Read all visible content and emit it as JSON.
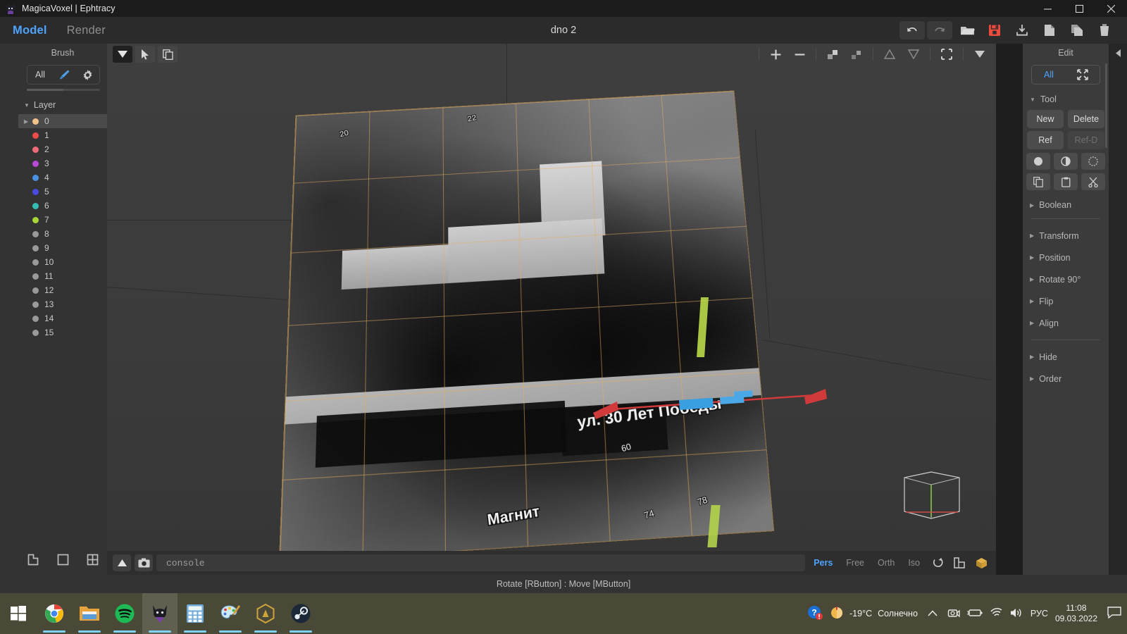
{
  "window": {
    "title": "MagicaVoxel | Ephtracy",
    "app_icon": "cat-icon",
    "controls": {
      "minimize": "minimize-icon",
      "maximize": "maximize-icon",
      "close": "close-icon"
    }
  },
  "menubar": {
    "items": [
      {
        "label": "Model",
        "active": true
      },
      {
        "label": "Render",
        "active": false
      }
    ],
    "document_title": "dno 2",
    "tools": [
      {
        "name": "undo-button",
        "icon": "undo-icon",
        "boxed": true,
        "color": "#cfcfcf"
      },
      {
        "name": "redo-button",
        "icon": "redo-icon",
        "boxed": true,
        "color": "#7a7a7a"
      },
      {
        "name": "open-button",
        "icon": "folder-open-icon",
        "boxed": false,
        "color": "#c6c6c6"
      },
      {
        "name": "save-button",
        "icon": "save-icon",
        "boxed": false,
        "color": "#ef4b3c"
      },
      {
        "name": "export-button",
        "icon": "download-icon",
        "boxed": false,
        "color": "#c6c6c6"
      },
      {
        "name": "new-button",
        "icon": "file-icon",
        "boxed": false,
        "color": "#c6c6c6"
      },
      {
        "name": "duplicate-button",
        "icon": "copy-icon",
        "boxed": false,
        "color": "#c6c6c6"
      },
      {
        "name": "delete-button",
        "icon": "trash-icon",
        "boxed": false,
        "color": "#c6c6c6"
      }
    ]
  },
  "left_panel": {
    "header": "Brush",
    "brush_bar": {
      "all_label": "All",
      "brush_icon": "paintbrush-icon",
      "settings_icon": "gear-icon"
    },
    "layer_section_label": "Layer",
    "layers": [
      {
        "index": "0",
        "color": "#f2c38a",
        "selected": true
      },
      {
        "index": "1",
        "color": "#f04b4b",
        "selected": false
      },
      {
        "index": "2",
        "color": "#f06a7a",
        "selected": false
      },
      {
        "index": "3",
        "color": "#b44ad6",
        "selected": false
      },
      {
        "index": "4",
        "color": "#4a8fe0",
        "selected": false
      },
      {
        "index": "5",
        "color": "#4a4ae0",
        "selected": false
      },
      {
        "index": "6",
        "color": "#35bdb5",
        "selected": false
      },
      {
        "index": "7",
        "color": "#a8d637",
        "selected": false
      },
      {
        "index": "8",
        "color": "#9a9a9a",
        "selected": false
      },
      {
        "index": "9",
        "color": "#9a9a9a",
        "selected": false
      },
      {
        "index": "10",
        "color": "#9a9a9a",
        "selected": false
      },
      {
        "index": "11",
        "color": "#9a9a9a",
        "selected": false
      },
      {
        "index": "12",
        "color": "#9a9a9a",
        "selected": false
      },
      {
        "index": "13",
        "color": "#9a9a9a",
        "selected": false
      },
      {
        "index": "14",
        "color": "#9a9a9a",
        "selected": false
      },
      {
        "index": "15",
        "color": "#9a9a9a",
        "selected": false
      }
    ],
    "bottom_icons_row1": [
      "corner-icon",
      "square-icon",
      "grid-icon"
    ],
    "bottom_icons_row2": [
      "blocks-icon",
      "cube-outline-icon",
      "cube-solid-icon"
    ]
  },
  "viewport": {
    "left_tools": [
      {
        "name": "brush-mode-dropdown",
        "icon": "triangle-down-icon",
        "style": "dark"
      },
      {
        "name": "select-tool",
        "icon": "cursor-icon",
        "style": "mid"
      },
      {
        "name": "copy-tool",
        "icon": "copy-icon",
        "style": "mid"
      }
    ],
    "right_tools": [
      {
        "name": "zoom-in-button",
        "icon": "plus-icon"
      },
      {
        "name": "zoom-out-button",
        "icon": "minus-icon"
      },
      {
        "name": "scale-up-button",
        "icon": "scale-up-icon"
      },
      {
        "name": "scale-down-button",
        "icon": "scale-down-icon"
      },
      {
        "name": "raise-button",
        "icon": "triangle-up-outline-icon"
      },
      {
        "name": "lower-button",
        "icon": "triangle-down-outline-icon"
      },
      {
        "name": "fit-button",
        "icon": "fit-icon"
      },
      {
        "name": "more-options-button",
        "icon": "triangle-down-icon"
      }
    ],
    "model": {
      "description": "aerial photo textured voxel plane",
      "street_label": "ул. 30 Лет Победы",
      "store_label": "Магнит",
      "map_numbers": [
        "20",
        "22",
        "60",
        "74",
        "78"
      ],
      "grid_color": "#e6af5f"
    },
    "gizmo": "bounding-box-gizmo"
  },
  "right_panel": {
    "header": "Edit",
    "all_bar": {
      "label": "All",
      "icon": "expand-icon"
    },
    "sections": [
      {
        "name": "Tool",
        "expanded": true
      },
      {
        "name": "Boolean",
        "expanded": false
      },
      {
        "name": "Transform",
        "expanded": false
      },
      {
        "name": "Position",
        "expanded": false
      },
      {
        "name": "Rotate 90°",
        "expanded": false
      },
      {
        "name": "Flip",
        "expanded": false
      },
      {
        "name": "Align",
        "expanded": false
      },
      {
        "name": "Hide",
        "expanded": false
      },
      {
        "name": "Order",
        "expanded": false
      }
    ],
    "tool_buttons": [
      {
        "label": "New",
        "disabled": false
      },
      {
        "label": "Delete",
        "disabled": false
      },
      {
        "label": "Ref",
        "disabled": false
      },
      {
        "label": "Ref-D",
        "disabled": true
      }
    ],
    "tool_icons_row1": [
      "circle-filled-icon",
      "circle-half-icon",
      "circle-dotted-icon"
    ],
    "tool_icons_row2": [
      "copy-icon",
      "paste-icon",
      "cut-icon"
    ]
  },
  "console": {
    "collapse_icon": "triangle-up-icon",
    "screenshot_icon": "camera-icon",
    "input_value": "console",
    "view_modes": [
      {
        "label": "Pers",
        "active": true
      },
      {
        "label": "Free",
        "active": false
      },
      {
        "label": "Orth",
        "active": false
      },
      {
        "label": "Iso",
        "active": false
      }
    ],
    "right_icons": [
      "rotate-icon",
      "grid-floor-icon",
      "cube-icon"
    ]
  },
  "statusbar": {
    "text": "Rotate [RButton] : Move [MButton]"
  },
  "taskbar": {
    "start_icon": "windows-icon",
    "apps": [
      {
        "name": "chrome",
        "icon": "chrome-icon",
        "active": false,
        "running": true
      },
      {
        "name": "explorer",
        "icon": "folder-icon",
        "active": false,
        "running": true
      },
      {
        "name": "spotify",
        "icon": "spotify-icon",
        "active": false,
        "running": true
      },
      {
        "name": "magicavoxel",
        "icon": "cat-icon",
        "active": true,
        "running": true
      },
      {
        "name": "calculator",
        "icon": "calculator-icon",
        "active": false,
        "running": true
      },
      {
        "name": "paint",
        "icon": "paint-icon",
        "active": false,
        "running": true
      },
      {
        "name": "autodesk",
        "icon": "hexagon-icon",
        "active": false,
        "running": true
      },
      {
        "name": "steam",
        "icon": "steam-icon",
        "active": false,
        "running": true
      }
    ],
    "tray": {
      "help_icon": "help-alert-icon",
      "weather_icon": "sun-icon",
      "temperature": "-19°C",
      "condition": "Солнечно",
      "chevron_icon": "chevron-up-icon",
      "icons": [
        "camera-tray-icon",
        "battery-icon",
        "wifi-icon",
        "volume-icon"
      ],
      "language": "РУС",
      "time": "11:08",
      "date": "09.03.2022",
      "notification_icon": "speech-bubble-icon"
    }
  }
}
